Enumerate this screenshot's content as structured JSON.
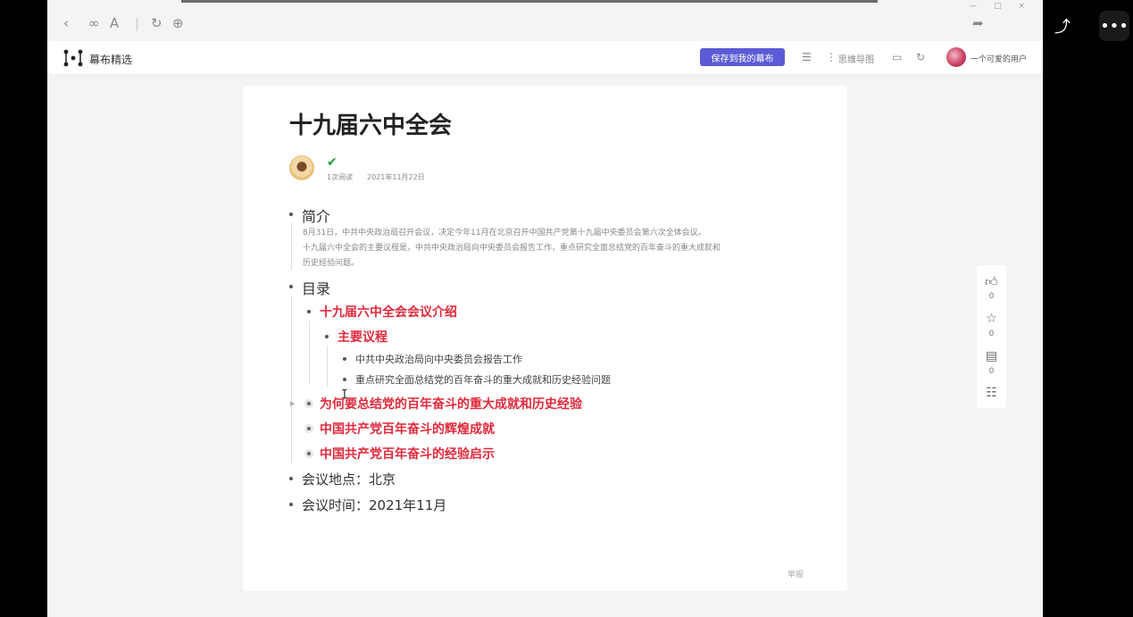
{
  "browser": {
    "window_controls": "— □ ×"
  },
  "header": {
    "brand": "幕布精选",
    "save_button": "保存到我的幕布",
    "mindmap_label": "思维导图",
    "user_name": "一个可爱的用户"
  },
  "doc": {
    "title": "十九届六中全会",
    "read_count": "1次阅读",
    "date": "2021年11月22日",
    "sections": {
      "intro_heading": "简介",
      "intro_lines": [
        "8月31日，中共中央政治局召开会议，决定今年11月在北京召开中国共产党第十九届中央委员会第六次全体会议。",
        "十九届六中全会的主要议程是，中共中央政治局向中央委员会报告工作，重点研究全面总结党的百年奋斗的重大成就和",
        "历史经验问题。"
      ],
      "toc_heading": "目录",
      "toc_item_1": "十九届六中全会会议介绍",
      "toc_sub_1": "主要议程",
      "toc_sub_1_items": [
        "中共中央政治局向中央委员会报告工作",
        "重点研究全面总结党的百年奋斗的重大成就和历史经验问题"
      ],
      "toc_item_2": "为何要总结党的百年奋斗的重大成就和历史经验",
      "toc_item_3": "中国共产党百年奋斗的辉煌成就",
      "toc_item_4": "中国共产党百年奋斗的经验启示",
      "location": "会议地点：北京",
      "time": "会议时间：2021年11月"
    },
    "report": "举报"
  },
  "rail": {
    "like_count": "0",
    "star_count": "0",
    "comment_count": "0"
  },
  "icons": [
    "back-icon",
    "link-icon",
    "text-size-icon",
    "refresh-icon",
    "globe-icon",
    "share-icon",
    "translate-icon",
    "rotate-icon",
    "more-icon",
    "list-icon",
    "mindmap-icon",
    "present-icon",
    "reload-icon",
    "like-icon",
    "star-icon",
    "comment-icon",
    "outline-icon",
    "check-icon"
  ],
  "colors": {
    "accent": "#5b5bd6",
    "highlight_red": "#e02a3c",
    "check_green": "#1e9e3a"
  }
}
